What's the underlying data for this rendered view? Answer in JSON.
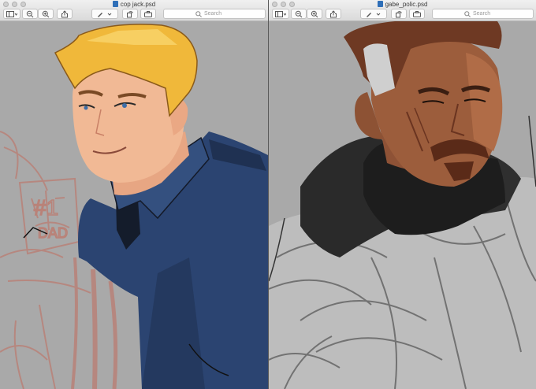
{
  "windows": [
    {
      "title": "cop jack.psd",
      "search_placeholder": "Search",
      "toolbar_icons": [
        "sidebar-toggle-icon",
        "zoom-out-icon",
        "zoom-in-icon",
        "share-icon",
        "markup-icon",
        "rotate-icon",
        "toolbox-icon"
      ]
    },
    {
      "title": "gabe_polic.psd",
      "search_placeholder": "Search",
      "toolbar_icons": [
        "sidebar-toggle-icon",
        "zoom-out-icon",
        "zoom-in-icon",
        "share-icon",
        "markup-icon",
        "rotate-icon",
        "toolbox-icon"
      ]
    }
  ],
  "sketch_text": "#1 DAD",
  "colors": {
    "canvas_gray": "#a9a9a9",
    "shirt_navy": "#2b4471",
    "hair_blonde": "#f0b83a",
    "skin_light": "#f1b995",
    "skin_dark": "#9c5d3c",
    "hair_brown": "#6e3923",
    "turtleneck_black": "#1d1d1d"
  }
}
